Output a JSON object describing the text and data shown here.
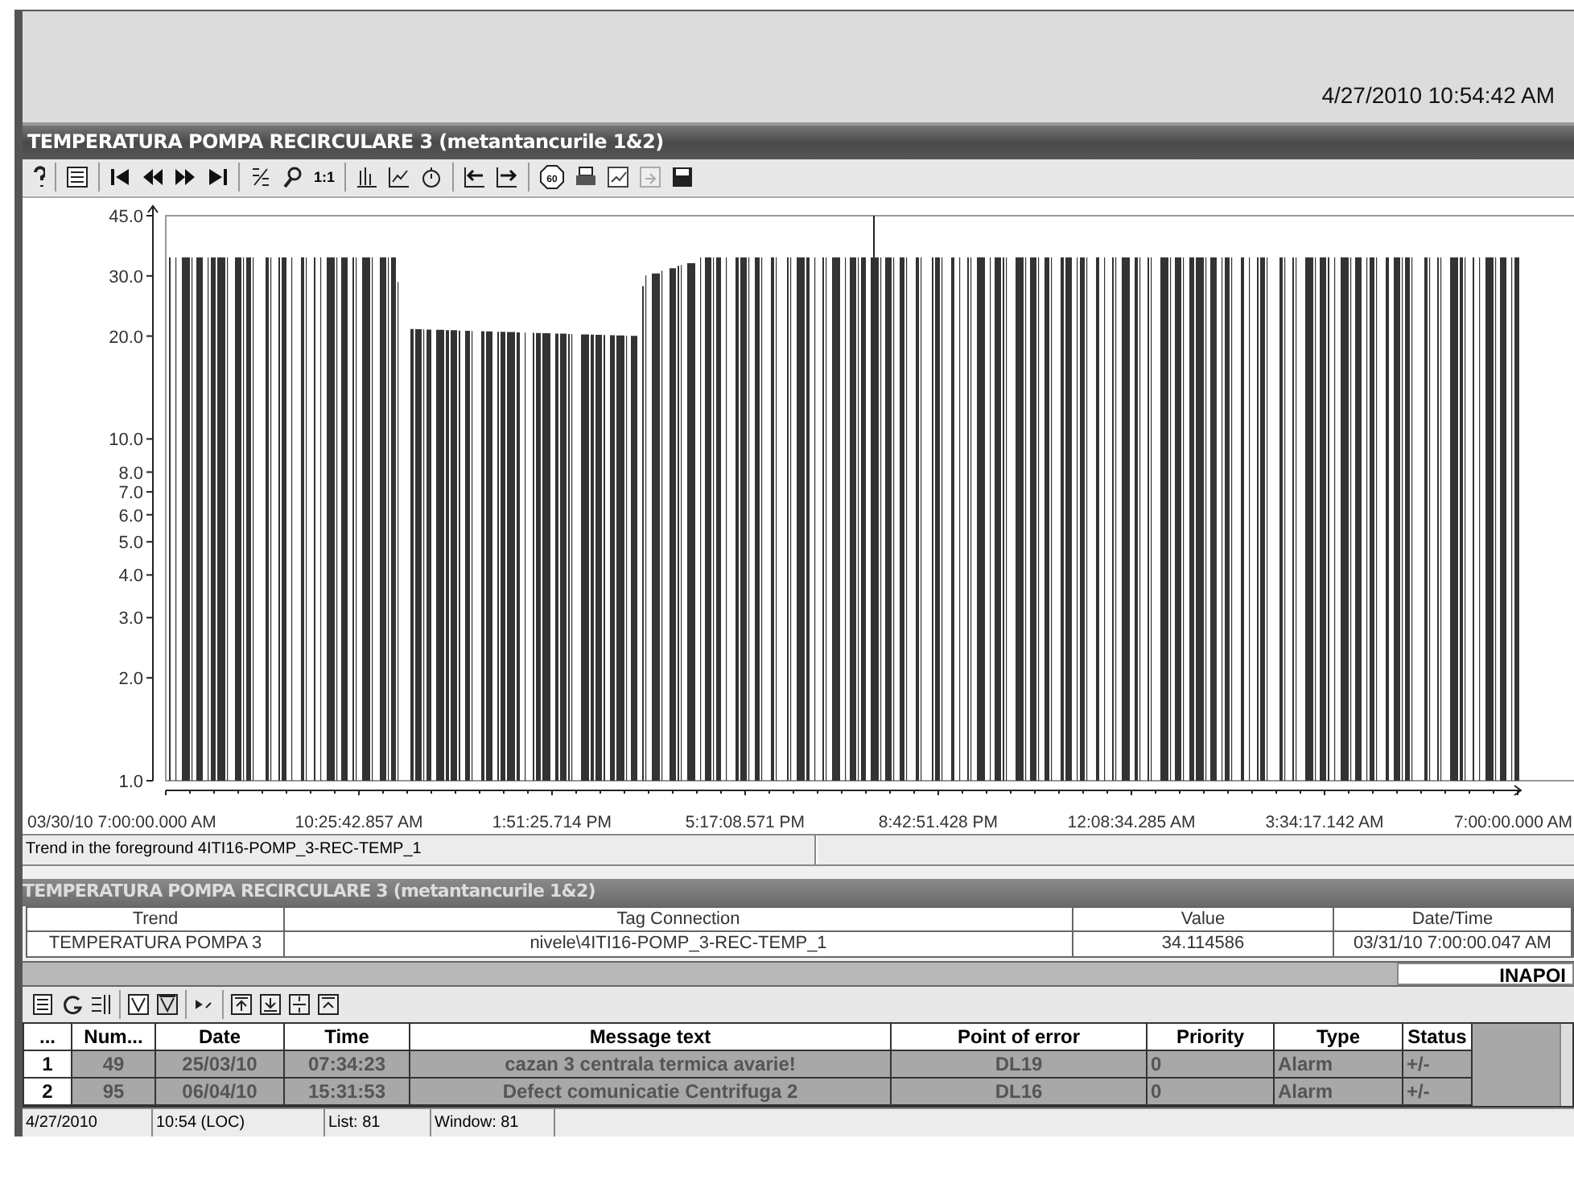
{
  "header": {
    "datetime": "4/27/2010 10:54:42 AM"
  },
  "trend_window": {
    "title": "TEMPERATURA POMPA RECIRCULARE 3 (metantancurile 1&2)",
    "toolbar": {
      "zoom_label": "1:1",
      "speed_label": "60"
    },
    "trend": {
      "y_ticks": [
        "45.0",
        "30.0",
        "20.0",
        "10.0",
        "8.0",
        "7.0",
        "6.0",
        "5.0",
        "4.0",
        "3.0",
        "2.0",
        "1.0"
      ],
      "x_ticks": [
        "03/30/10  7:00:00.000 AM",
        "10:25:42.857 AM",
        "1:51:25.714 PM",
        "5:17:08.571 PM",
        "8:42:51.428 PM",
        "12:08:34.285 AM",
        "3:34:17.142 AM",
        "7:00:00.000 AM"
      ]
    },
    "status": "Trend in the foreground 4ITI16-POMP_3-REC-TEMP_1"
  },
  "legend": {
    "title": "TEMPERATURA POMPA RECIRCULARE 3 (metantancurile 1&2)",
    "columns": [
      "Trend",
      "Tag Connection",
      "Value",
      "Date/Time"
    ],
    "rows": [
      [
        "TEMPERATURA POMPA 3",
        "nivele\\4ITI16-POMP_3-REC-TEMP_1",
        "34.114586",
        "03/31/10 7:00:00.047 AM"
      ]
    ]
  },
  "back_button": "INAPOI",
  "alarms": {
    "columns": [
      "...",
      "Num...",
      "Date",
      "Time",
      "Message text",
      "Point of error",
      "Priority",
      "Type",
      "Status"
    ],
    "rows": [
      [
        "1",
        "49",
        "25/03/10",
        "07:34:23",
        "cazan 3 centrala termica avarie!",
        "DL19",
        "0",
        "Alarm",
        "+/-"
      ],
      [
        "2",
        "95",
        "06/04/10",
        "15:31:53",
        "Defect comunicatie Centrifuga 2",
        "DL16",
        "0",
        "Alarm",
        "+/-"
      ]
    ]
  },
  "status_bar": [
    "4/27/2010",
    "10:54 (LOC)",
    "List: 81",
    "Window: 81"
  ]
}
